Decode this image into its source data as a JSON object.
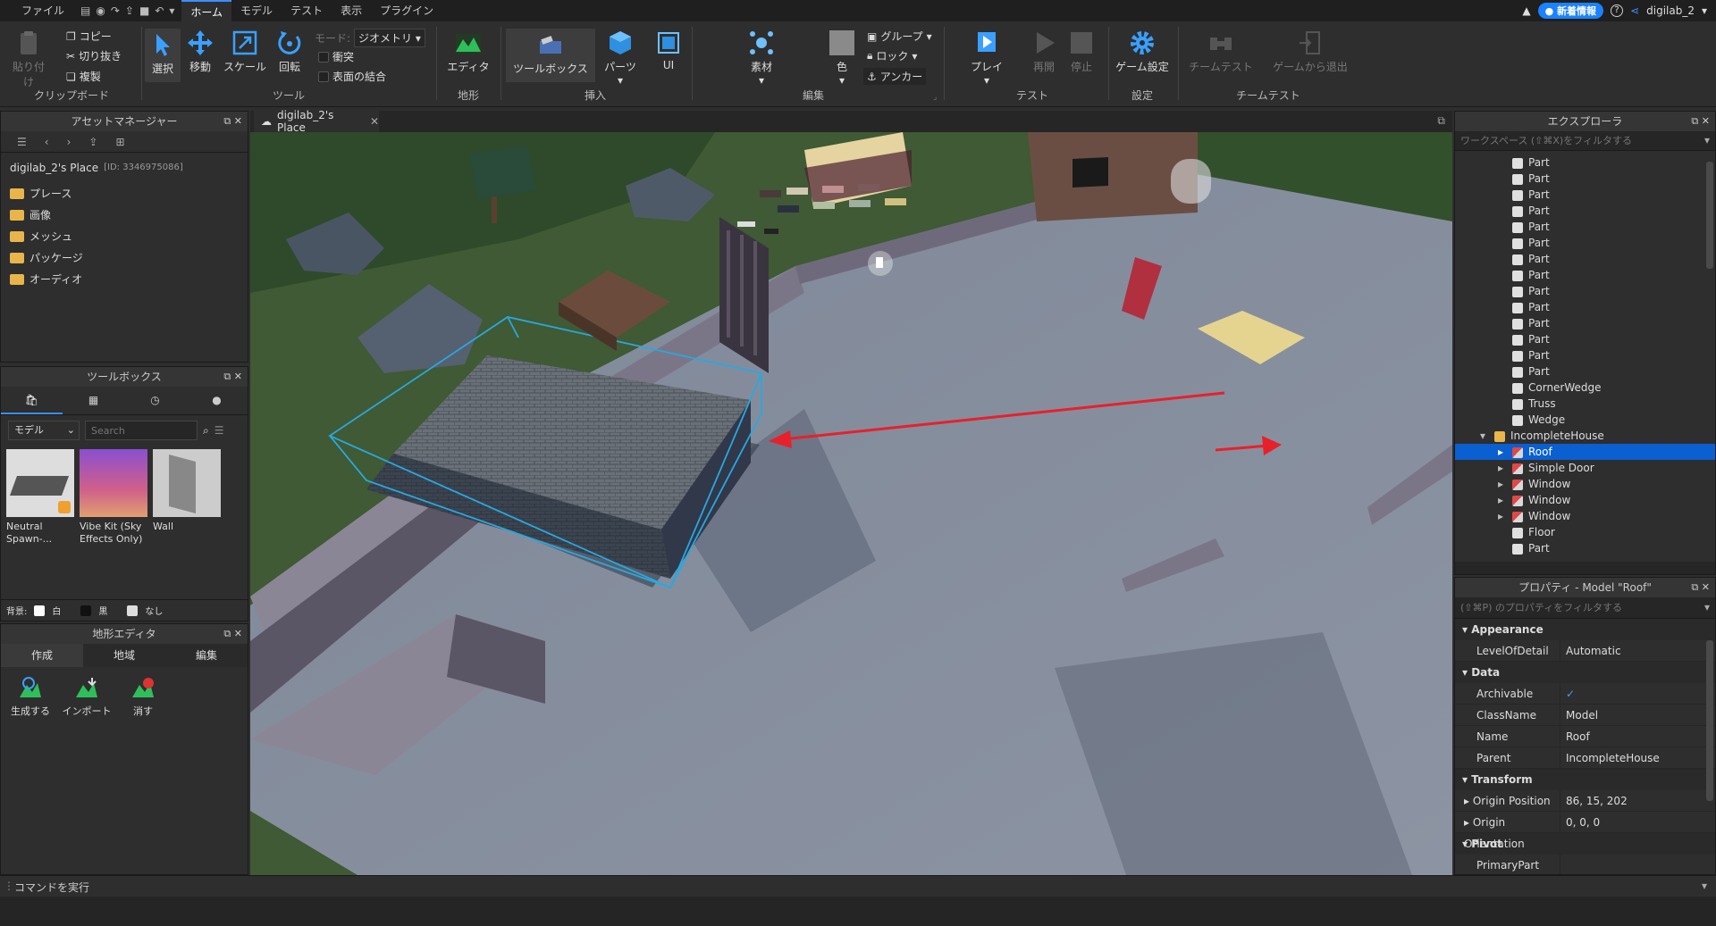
{
  "menubar": {
    "items": [
      "ファイル",
      "ホーム",
      "モデル",
      "テスト",
      "表示",
      "プラグイン"
    ],
    "active": "ホーム",
    "news_label": "新着情報",
    "user": "digilab_2"
  },
  "ribbon": {
    "clipboard": {
      "paste": "貼り付け",
      "copy": "コピー",
      "cut": "切り抜き",
      "duplicate": "複製",
      "group_label": "クリップボード"
    },
    "tools": {
      "select": "選択",
      "move": "移動",
      "scale": "スケール",
      "rotate": "回転",
      "mode_label": "モード:",
      "mode_value": "ジオメトリ",
      "collision": "衝突",
      "join_surfaces": "表面の結合",
      "group_label": "ツール"
    },
    "terrain": {
      "editor": "エディタ",
      "group_label": "地形"
    },
    "insert": {
      "toolbox": "ツールボックス",
      "part": "パーツ",
      "ui": "UI",
      "group_label": "挿入"
    },
    "edit": {
      "material": "素材",
      "color": "色",
      "group": "グループ",
      "lock": "ロック",
      "anchor": "アンカー",
      "group_label": "編集"
    },
    "test": {
      "play": "プレイ",
      "resume": "再開",
      "stop": "停止",
      "group_label": "テスト"
    },
    "settings": {
      "game_settings": "ゲーム設定",
      "group_label": "設定"
    },
    "team_test": {
      "team_test": "チームテスト",
      "exit_game": "ゲームから退出",
      "group_label": "チームテスト"
    }
  },
  "asset_manager": {
    "title": "アセットマネージャー",
    "place_name": "digilab_2's Place",
    "place_id": "[ID: 3346975086]",
    "folders": [
      "プレース",
      "画像",
      "メッシュ",
      "パッケージ",
      "オーディオ"
    ]
  },
  "toolbox": {
    "title": "ツールボックス",
    "category": "モデル",
    "search_placeholder": "Search",
    "items": [
      {
        "label": "Neutral Spawn-..."
      },
      {
        "label": "Vibe Kit (Sky Effects Only)"
      },
      {
        "label": "Wall"
      }
    ],
    "background_label": "背景:",
    "bg_options": [
      "白",
      "黒",
      "なし"
    ]
  },
  "terrain_editor": {
    "title": "地形エディタ",
    "tabs": [
      "作成",
      "地域",
      "編集"
    ],
    "actions": [
      "生成する",
      "インポート",
      "消す"
    ]
  },
  "viewport": {
    "tab_label": "digilab_2's Place"
  },
  "explorer": {
    "title": "エクスプローラ",
    "filter_placeholder": "ワークスペース (⇧⌘X)をフィルタする",
    "items": [
      {
        "label": "Part",
        "depth": 2,
        "icon": "part",
        "arrow": false,
        "selected": false
      },
      {
        "label": "Part",
        "depth": 2,
        "icon": "part",
        "arrow": false,
        "selected": false
      },
      {
        "label": "Part",
        "depth": 2,
        "icon": "part",
        "arrow": false,
        "selected": false
      },
      {
        "label": "Part",
        "depth": 2,
        "icon": "part",
        "arrow": false,
        "selected": false
      },
      {
        "label": "Part",
        "depth": 2,
        "icon": "part",
        "arrow": false,
        "selected": false
      },
      {
        "label": "Part",
        "depth": 2,
        "icon": "part",
        "arrow": false,
        "selected": false
      },
      {
        "label": "Part",
        "depth": 2,
        "icon": "part",
        "arrow": false,
        "selected": false
      },
      {
        "label": "Part",
        "depth": 2,
        "icon": "part",
        "arrow": false,
        "selected": false
      },
      {
        "label": "Part",
        "depth": 2,
        "icon": "part",
        "arrow": false,
        "selected": false
      },
      {
        "label": "Part",
        "depth": 2,
        "icon": "part",
        "arrow": false,
        "selected": false
      },
      {
        "label": "Part",
        "depth": 2,
        "icon": "part",
        "arrow": false,
        "selected": false
      },
      {
        "label": "Part",
        "depth": 2,
        "icon": "part",
        "arrow": false,
        "selected": false
      },
      {
        "label": "Part",
        "depth": 2,
        "icon": "part",
        "arrow": false,
        "selected": false
      },
      {
        "label": "Part",
        "depth": 2,
        "icon": "part",
        "arrow": false,
        "selected": false
      },
      {
        "label": "CornerWedge",
        "depth": 2,
        "icon": "part",
        "arrow": false,
        "selected": false
      },
      {
        "label": "Truss",
        "depth": 2,
        "icon": "part",
        "arrow": false,
        "selected": false
      },
      {
        "label": "Wedge",
        "depth": 2,
        "icon": "part",
        "arrow": false,
        "selected": false
      },
      {
        "label": "IncompleteHouse",
        "depth": 1,
        "icon": "folder",
        "arrow": "open",
        "selected": false
      },
      {
        "label": "Roof",
        "depth": 2,
        "icon": "model",
        "arrow": "closed",
        "selected": true
      },
      {
        "label": "Simple Door",
        "depth": 2,
        "icon": "model",
        "arrow": "closed",
        "selected": false
      },
      {
        "label": "Window",
        "depth": 2,
        "icon": "model",
        "arrow": "closed",
        "selected": false
      },
      {
        "label": "Window",
        "depth": 2,
        "icon": "model",
        "arrow": "closed",
        "selected": false
      },
      {
        "label": "Window",
        "depth": 2,
        "icon": "model",
        "arrow": "closed",
        "selected": false
      },
      {
        "label": "Floor",
        "depth": 2,
        "icon": "part",
        "arrow": false,
        "selected": false
      },
      {
        "label": "Part",
        "depth": 2,
        "icon": "part",
        "arrow": false,
        "selected": false
      }
    ]
  },
  "properties": {
    "title": "プロパティ - Model \"Roof\"",
    "filter_placeholder": "(⇧⌘P) のプロパティをフィルタする",
    "sections": {
      "appearance": "Appearance",
      "data": "Data",
      "transform": "Transform",
      "pivot": "Pivot"
    },
    "rows": {
      "level_of_detail": {
        "k": "LevelOfDetail",
        "v": "Automatic"
      },
      "archivable": {
        "k": "Archivable",
        "v": "✓"
      },
      "classname": {
        "k": "ClassName",
        "v": "Model"
      },
      "name": {
        "k": "Name",
        "v": "Roof"
      },
      "parent": {
        "k": "Parent",
        "v": "IncompleteHouse"
      },
      "origin_position": {
        "k": "Origin Position",
        "v": "86, 15, 202"
      },
      "origin_orientation": {
        "k": "Origin Orientation",
        "v": "0, 0, 0"
      },
      "primary_part": {
        "k": "PrimaryPart",
        "v": ""
      }
    }
  },
  "command_bar": {
    "placeholder": "コマンドを実行"
  },
  "colors": {
    "accent": "#1a82ff",
    "selection": "#0a5fd1",
    "arrow": "#e8202a",
    "selection_box": "#29a8e0"
  }
}
